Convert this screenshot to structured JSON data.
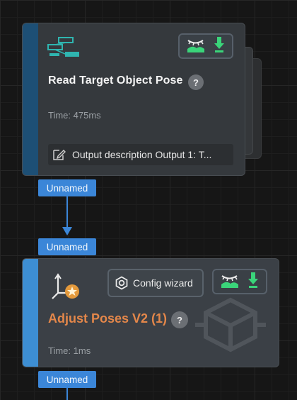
{
  "nodes": [
    {
      "title": "Read Target Object Pose",
      "help": "?",
      "time": "Time: 475ms",
      "description": "Output description Output 1: T...",
      "output_port": "Unnamed"
    },
    {
      "input_port": "Unnamed",
      "title": "Adjust Poses V2 (1)",
      "help": "?",
      "config_label": "Config wizard",
      "time": "Time: 1ms",
      "output_port": "Unnamed"
    }
  ],
  "colors": {
    "accent_blue": "#3b86d8",
    "title_orange": "#e4874a",
    "icon_green": "#3ad47a"
  },
  "icons": {
    "node1_type": "network-nodes-icon",
    "node2_type": "pose-axes-star-icon",
    "visualize": "eye-landscape-icon",
    "download": "green-down-arrow-icon",
    "edit": "edit-note-icon",
    "config": "hexagon-gear-icon",
    "watermark": "cube-watermark-icon"
  }
}
